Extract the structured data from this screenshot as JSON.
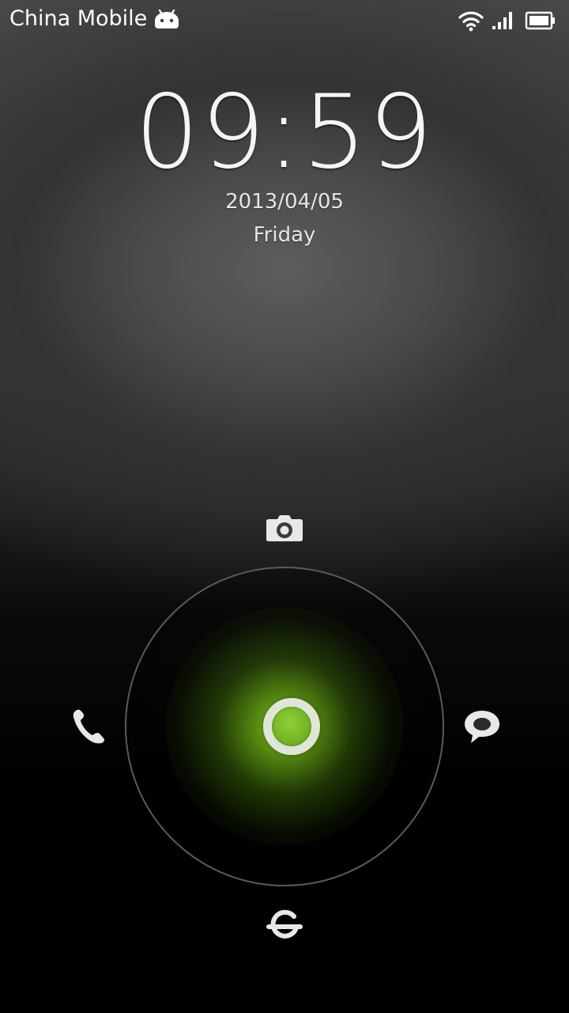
{
  "status_bar": {
    "carrier": "China Mobile",
    "icons": [
      "android-icon",
      "wifi-icon",
      "signal-icon",
      "battery-icon"
    ]
  },
  "lockscreen": {
    "time": "09:59",
    "date": "2013/04/05",
    "weekday": "Friday"
  },
  "unlock": {
    "targets": [
      "camera-icon",
      "phone-icon",
      "message-icon",
      "unlock-icon"
    ],
    "accent_color": "#7ec02a",
    "ring_color": "#5a5a5a"
  }
}
